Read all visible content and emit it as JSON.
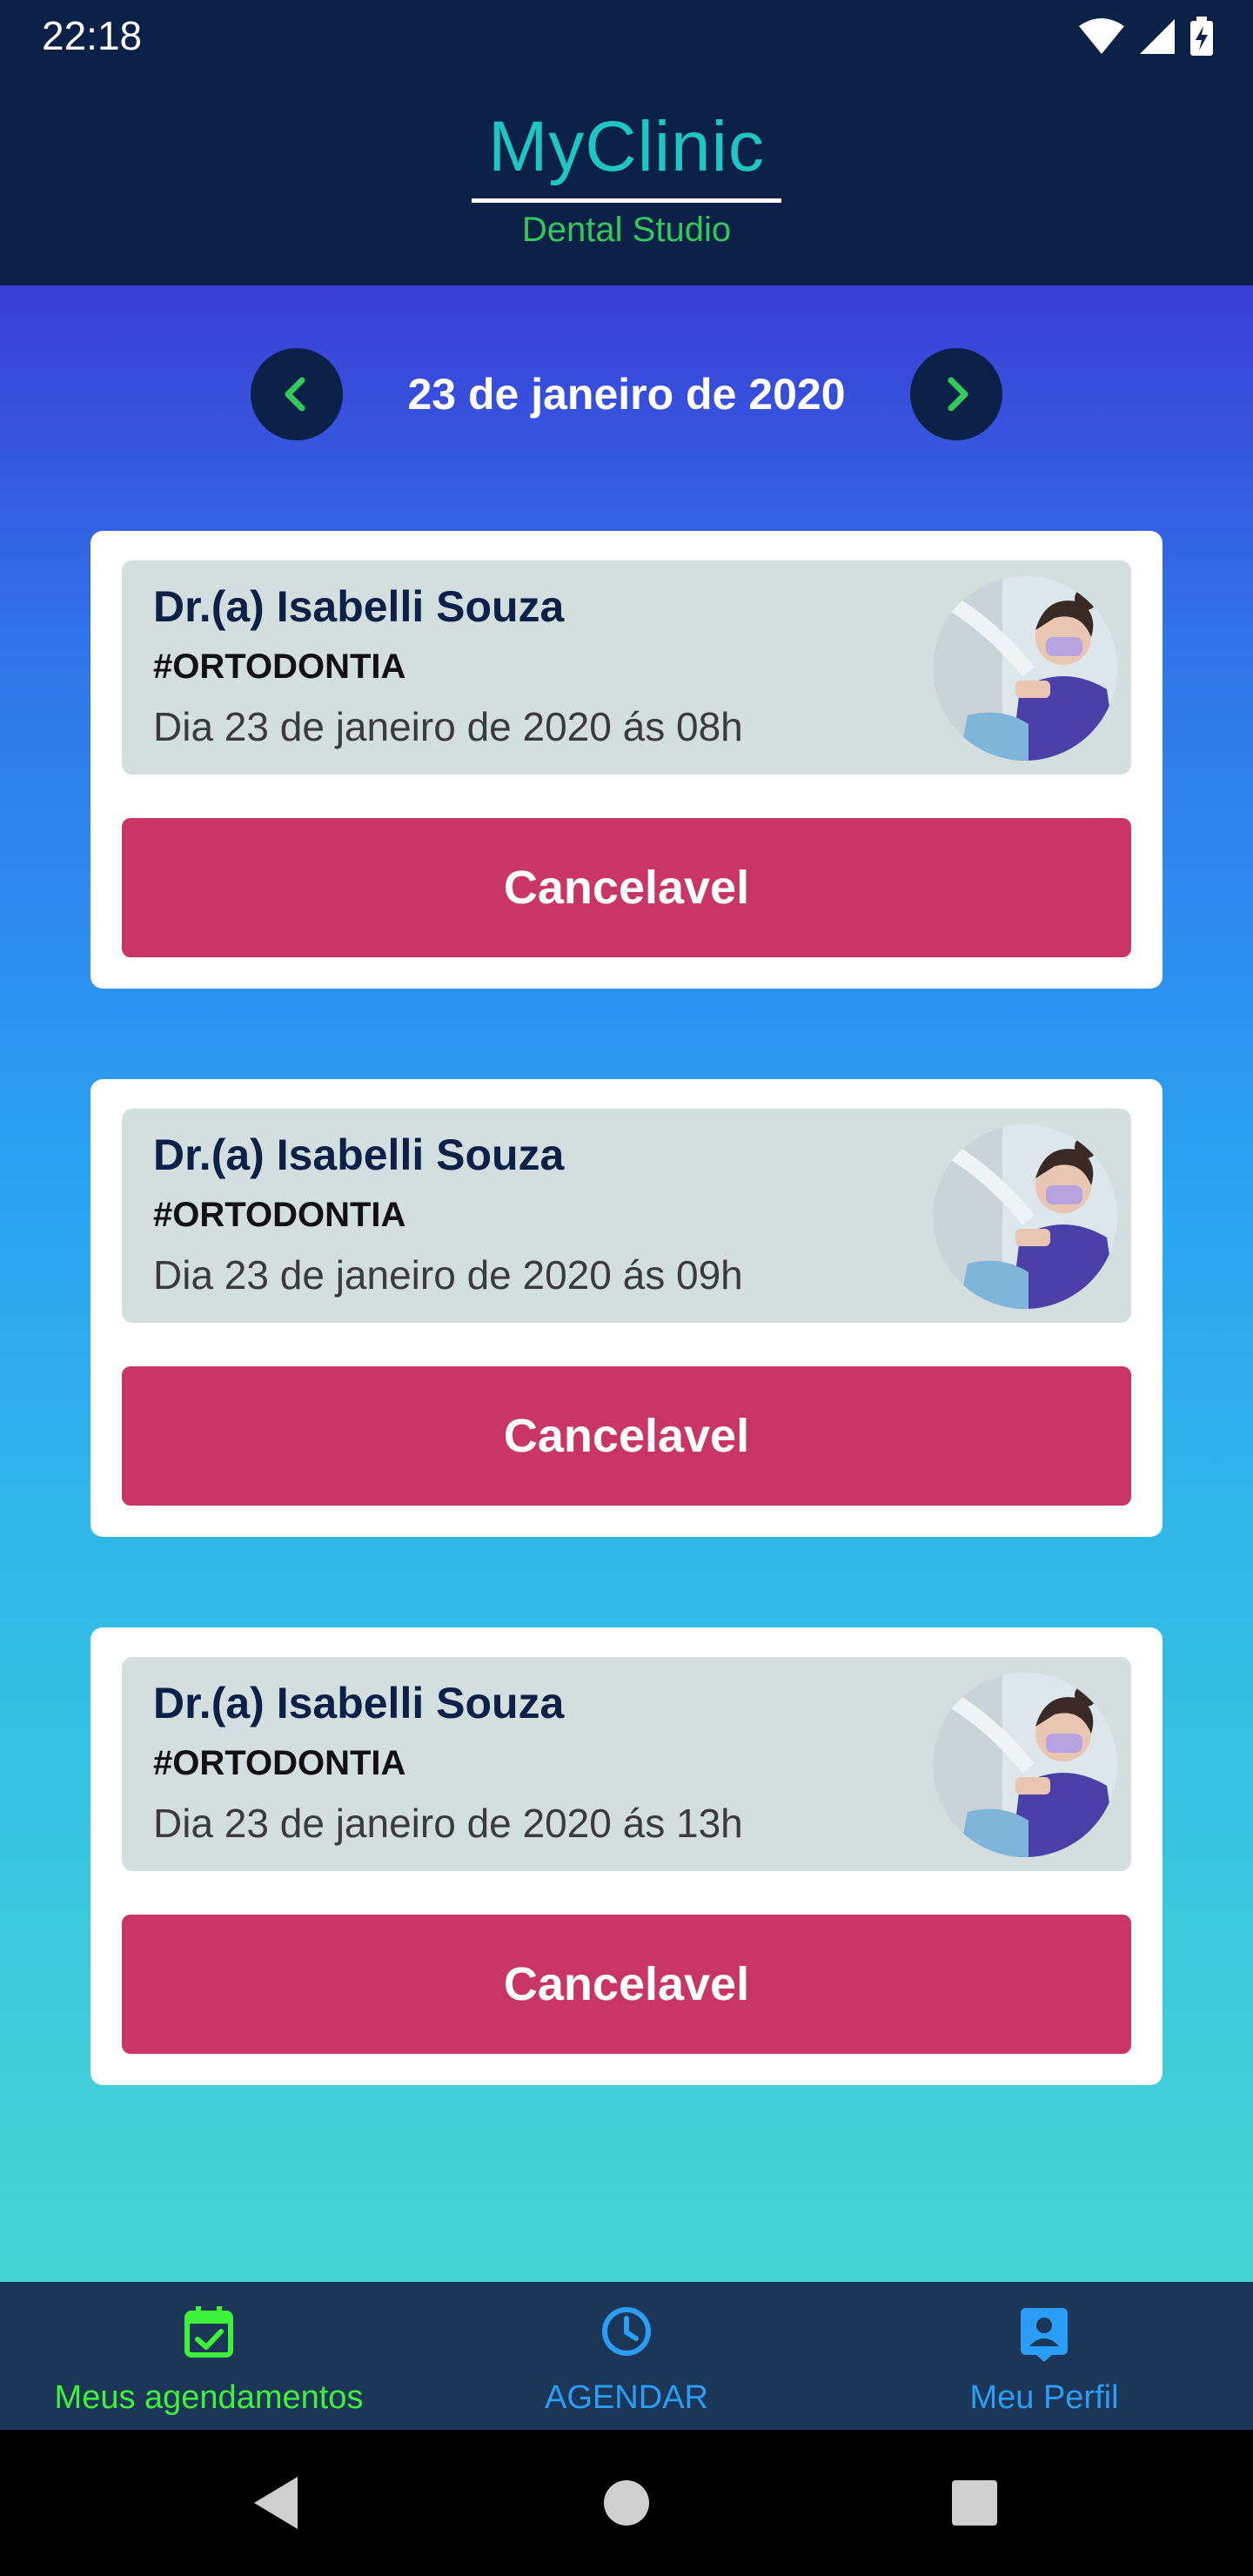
{
  "status_bar": {
    "time": "22:18",
    "icons": [
      "wifi-icon",
      "signal-icon",
      "battery-charging-icon"
    ]
  },
  "header": {
    "app_name": "MyClinic",
    "subtitle": "Dental Studio"
  },
  "date_nav": {
    "date": "23 de janeiro de 2020",
    "prev_icon": "chevron-left-icon",
    "next_icon": "chevron-right-icon"
  },
  "appointments": [
    {
      "doctor": "Dr.(a) Isabelli Souza",
      "specialty": "#ORTODONTIA",
      "when": "Dia 23 de janeiro de 2020 ás 08h",
      "action": "Cancelavel"
    },
    {
      "doctor": "Dr.(a) Isabelli Souza",
      "specialty": "#ORTODONTIA",
      "when": "Dia 23 de janeiro de 2020 ás 09h",
      "action": "Cancelavel"
    },
    {
      "doctor": "Dr.(a) Isabelli Souza",
      "specialty": "#ORTODONTIA",
      "when": "Dia 23 de janeiro de 2020 ás 13h",
      "action": "Cancelavel"
    }
  ],
  "bottom_nav": [
    {
      "label": "Meus agendamentos",
      "icon": "calendar-check-icon",
      "active": true
    },
    {
      "label": "AGENDAR",
      "icon": "clock-icon",
      "active": false
    },
    {
      "label": "Meu Perfil",
      "icon": "profile-card-icon",
      "active": false
    }
  ],
  "colors": {
    "header_bg": "#0b2147",
    "brand": "#1fc5c0",
    "accent_green": "#34c759",
    "cancel": "#c93567",
    "tab_inactive": "#2a9df4",
    "tab_active": "#3ef23a"
  }
}
